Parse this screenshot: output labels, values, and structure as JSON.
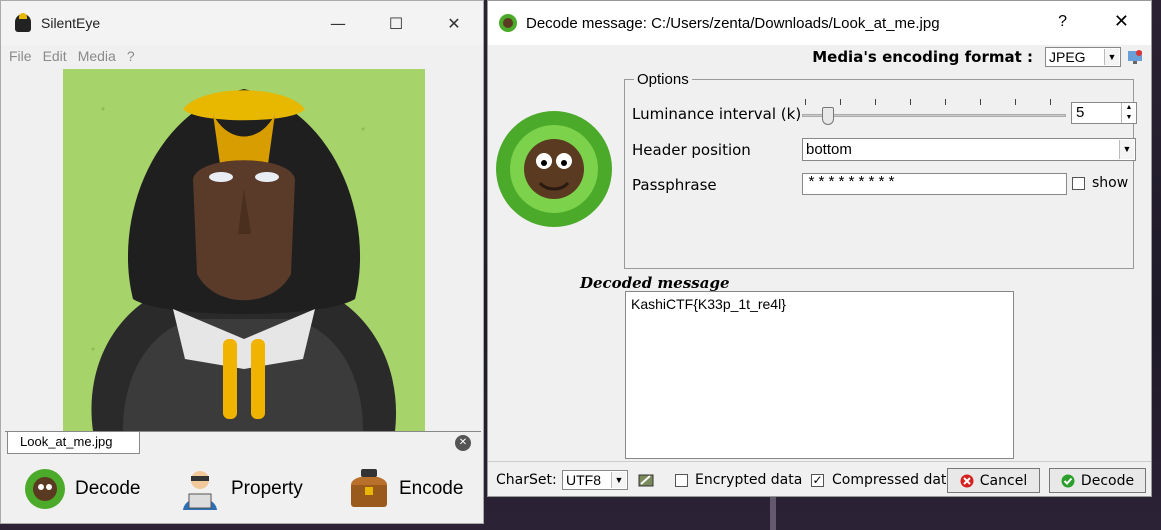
{
  "main_window": {
    "title": "SilentEye",
    "controls": {
      "minimize": "—",
      "maximize": "☐",
      "close": "✕"
    },
    "menu": [
      "File",
      "Edit",
      "Media",
      "?"
    ],
    "tab_label": "Look_at_me.jpg",
    "actions": {
      "decode": "Decode",
      "property": "Property",
      "encode": "Encode"
    }
  },
  "decode_dialog": {
    "title": "Decode message: C:/Users/zenta/Downloads/Look_at_me.jpg",
    "help": "?",
    "close": "✕",
    "encoding_format_label": "Media's encoding format :",
    "encoding_format_value": "JPEG",
    "options_legend": "Options",
    "luminance_label": "Luminance interval (k)",
    "luminance_value": "5",
    "header_position_label": "Header position",
    "header_position_value": "bottom",
    "passphrase_label": "Passphrase",
    "passphrase_value": "*********",
    "show_label": "show",
    "decoded_label": "Decoded message",
    "decoded_text": "KashiCTF{K33p_1t_re4l}",
    "charset_label": "CharSet:",
    "charset_value": "UTF8",
    "encrypted_label": "Encrypted data",
    "compressed_label": "Compressed dat",
    "cancel_label": "Cancel",
    "decode_label": "Decode"
  },
  "colors": {
    "image_bg": "#a6d36a",
    "hood_accent": "#e8b800"
  }
}
